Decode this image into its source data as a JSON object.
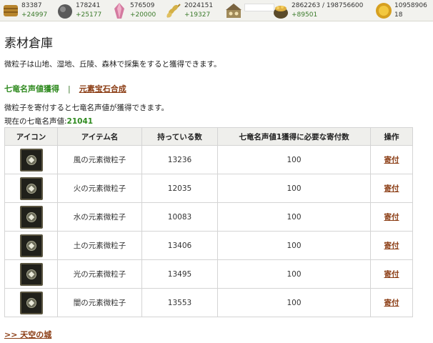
{
  "resources": [
    {
      "icon": "wood-icon",
      "amount": "83387",
      "delta": "+24997",
      "color": "#b8862e"
    },
    {
      "icon": "stone-icon",
      "amount": "178241",
      "delta": "+25177",
      "color": "#6d6d6d"
    },
    {
      "icon": "crystal-icon",
      "amount": "576509",
      "delta": "+20000",
      "color": "#d47aa0"
    },
    {
      "icon": "wheat-icon",
      "amount": "2024151",
      "delta": "+19327",
      "color": "#d4b046"
    },
    {
      "icon": "population-icon",
      "amount": "",
      "delta": "",
      "color": "#a08a5a"
    },
    {
      "icon": "gold-pot-icon",
      "amount": "2862263 / 198756600",
      "delta": "+89501",
      "color": "#c89a30"
    },
    {
      "icon": "coin-icon",
      "amount": "10958906",
      "delta": "",
      "color": "#d6a020",
      "extra": "18"
    }
  ],
  "page_title": "素材倉庫",
  "description": "微粒子は山地、湿地、丘陵、森林で採集をすると獲得できます。",
  "subnav": {
    "active": "七竜名声値獲得",
    "separator": "|",
    "link": "元素宝石合成"
  },
  "donate_description": "微粒子を寄付すると七竜名声値が獲得できます。",
  "current": {
    "label": "現在の七竜名声値:",
    "value": "21041"
  },
  "table": {
    "headers": [
      "アイコン",
      "アイテム名",
      "持っている数",
      "七竜名声値1獲得に必要な寄付数",
      "操作"
    ],
    "rows": [
      {
        "name": "風の元素微粒子",
        "owned": "13236",
        "required": "100",
        "action": "寄付"
      },
      {
        "name": "火の元素微粒子",
        "owned": "12035",
        "required": "100",
        "action": "寄付"
      },
      {
        "name": "水の元素微粒子",
        "owned": "10083",
        "required": "100",
        "action": "寄付"
      },
      {
        "name": "土の元素微粒子",
        "owned": "13406",
        "required": "100",
        "action": "寄付"
      },
      {
        "name": "光の元素微粒子",
        "owned": "13495",
        "required": "100",
        "action": "寄付"
      },
      {
        "name": "闇の元素微粒子",
        "owned": "13553",
        "required": "100",
        "action": "寄付"
      }
    ]
  },
  "footer_link": ">> 天空の城"
}
